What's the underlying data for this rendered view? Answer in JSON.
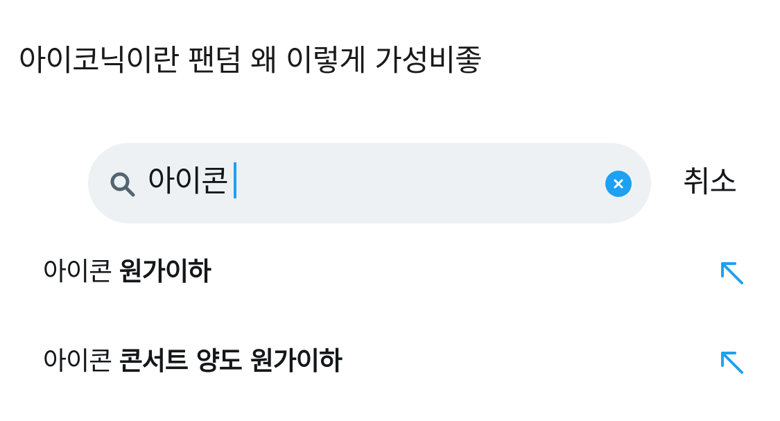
{
  "caption": "아이코닉이란 팬덤 왜 이렇게 가성비좋",
  "search": {
    "value": "아이콘",
    "clear_icon": "clear-x-icon",
    "search_icon": "magnifier-icon"
  },
  "cancel_label": "취소",
  "suggestions": [
    {
      "prefix": "아이콘 ",
      "completion": "원가이하",
      "icon": "arrow-up-left-icon"
    },
    {
      "prefix": "아이콘 ",
      "completion": "콘서트 양도 원가이하",
      "icon": "arrow-up-left-icon"
    }
  ],
  "colors": {
    "accent": "#1da1f2",
    "search_bg": "#eef1f3",
    "text": "#14171a"
  }
}
